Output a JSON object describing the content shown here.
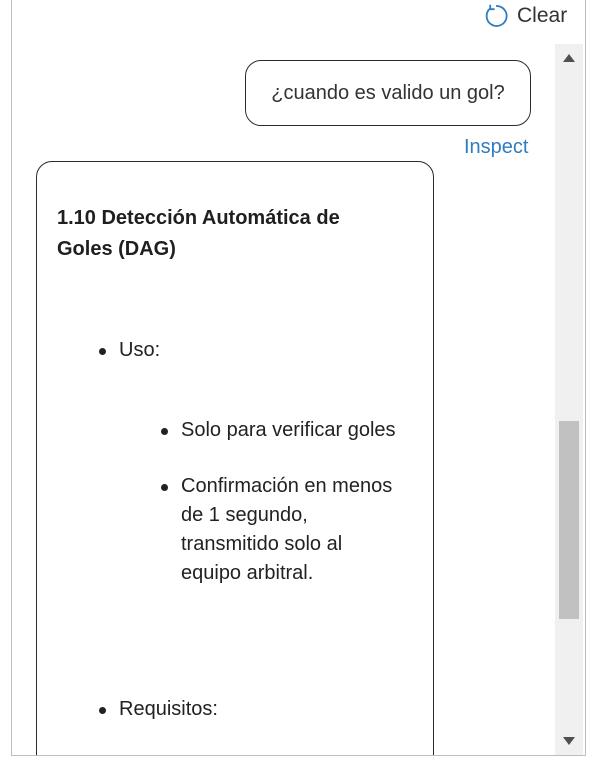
{
  "header": {
    "clear_label": "Clear",
    "clear_icon": "refresh-icon"
  },
  "conversation": {
    "user_message": "¿cuando es valido un gol?",
    "inspect_label": "Inspect",
    "bot_message": {
      "title": "1.10 Detección Automática de Goles (DAG)",
      "sections": [
        {
          "label": "Uso:",
          "items": [
            "Solo para verificar goles",
            "Confirmación en menos de 1 segundo, transmitido solo al equipo arbitral."
          ]
        },
        {
          "label": "Requisitos:",
          "items": []
        }
      ]
    }
  },
  "colors": {
    "accent_link": "#2f7cc1",
    "bubble_border": "#2b2b2b",
    "scroll_track": "#f0f0f0",
    "scroll_thumb": "#c1c1c1"
  }
}
